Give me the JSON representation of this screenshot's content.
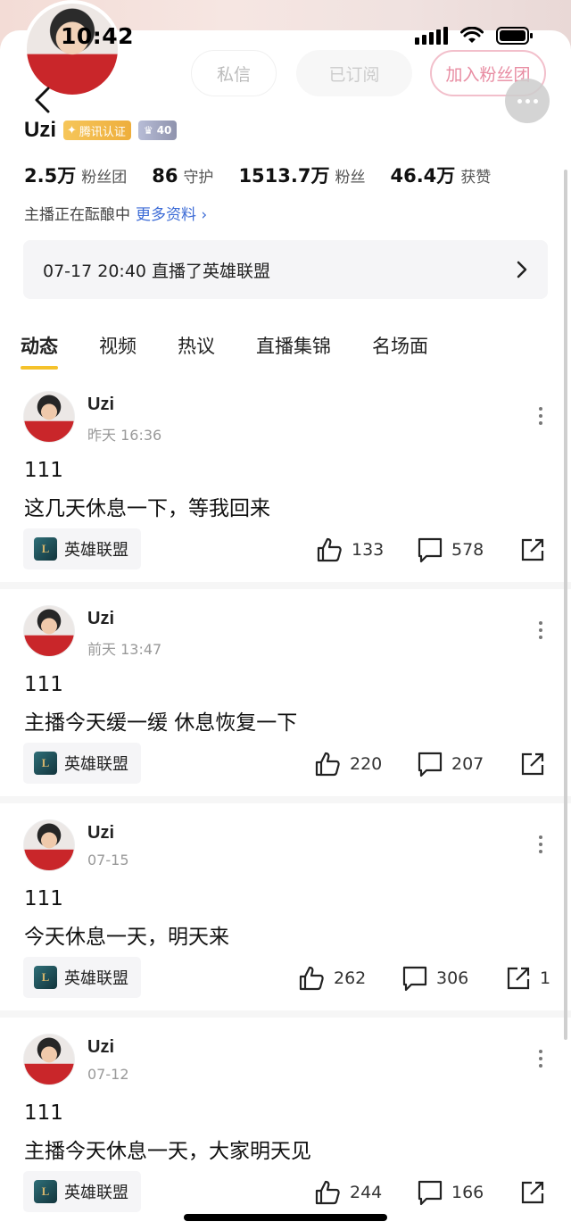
{
  "status_bar": {
    "time": "10:42"
  },
  "header": {
    "dm_label": "私信",
    "subscribed_label": "已订阅",
    "join_fan_club_label": "加入粉丝团"
  },
  "profile": {
    "name": "Uzi",
    "cert_label": "腾讯认证",
    "level": "40",
    "stats": [
      {
        "num": "2.5万",
        "unit": "粉丝团"
      },
      {
        "num": "86",
        "unit": "守护"
      },
      {
        "num": "1513.7万",
        "unit": "粉丝"
      },
      {
        "num": "46.4万",
        "unit": "获赞"
      }
    ],
    "bio": "主播正在酝酿中",
    "more_info_label": "更多资料"
  },
  "live_card": {
    "text": "07-17 20:40 直播了英雄联盟"
  },
  "tabs": [
    "动态",
    "视频",
    "热议",
    "直播集锦",
    "名场面"
  ],
  "posts": [
    {
      "author": "Uzi",
      "time": "昨天 16:36",
      "line1": "111",
      "line2": "这几天休息一下，等我回来",
      "game": "英雄联盟",
      "likes": "133",
      "comments": "578",
      "shares": ""
    },
    {
      "author": "Uzi",
      "time": "前天 13:47",
      "line1": "111",
      "line2": "主播今天缓一缓 休息恢复一下",
      "game": "英雄联盟",
      "likes": "220",
      "comments": "207",
      "shares": ""
    },
    {
      "author": "Uzi",
      "time": "07-15",
      "line1": "111",
      "line2": "今天休息一天，明天来",
      "game": "英雄联盟",
      "likes": "262",
      "comments": "306",
      "shares": "1"
    },
    {
      "author": "Uzi",
      "time": "07-12",
      "line1": "111",
      "line2": "主播今天休息一天，大家明天见",
      "game": "英雄联盟",
      "likes": "244",
      "comments": "166",
      "shares": ""
    }
  ],
  "colors": {
    "tab_underline": "#f5c22b",
    "link": "#3c6bd6",
    "join_button": "#e88ca2"
  }
}
